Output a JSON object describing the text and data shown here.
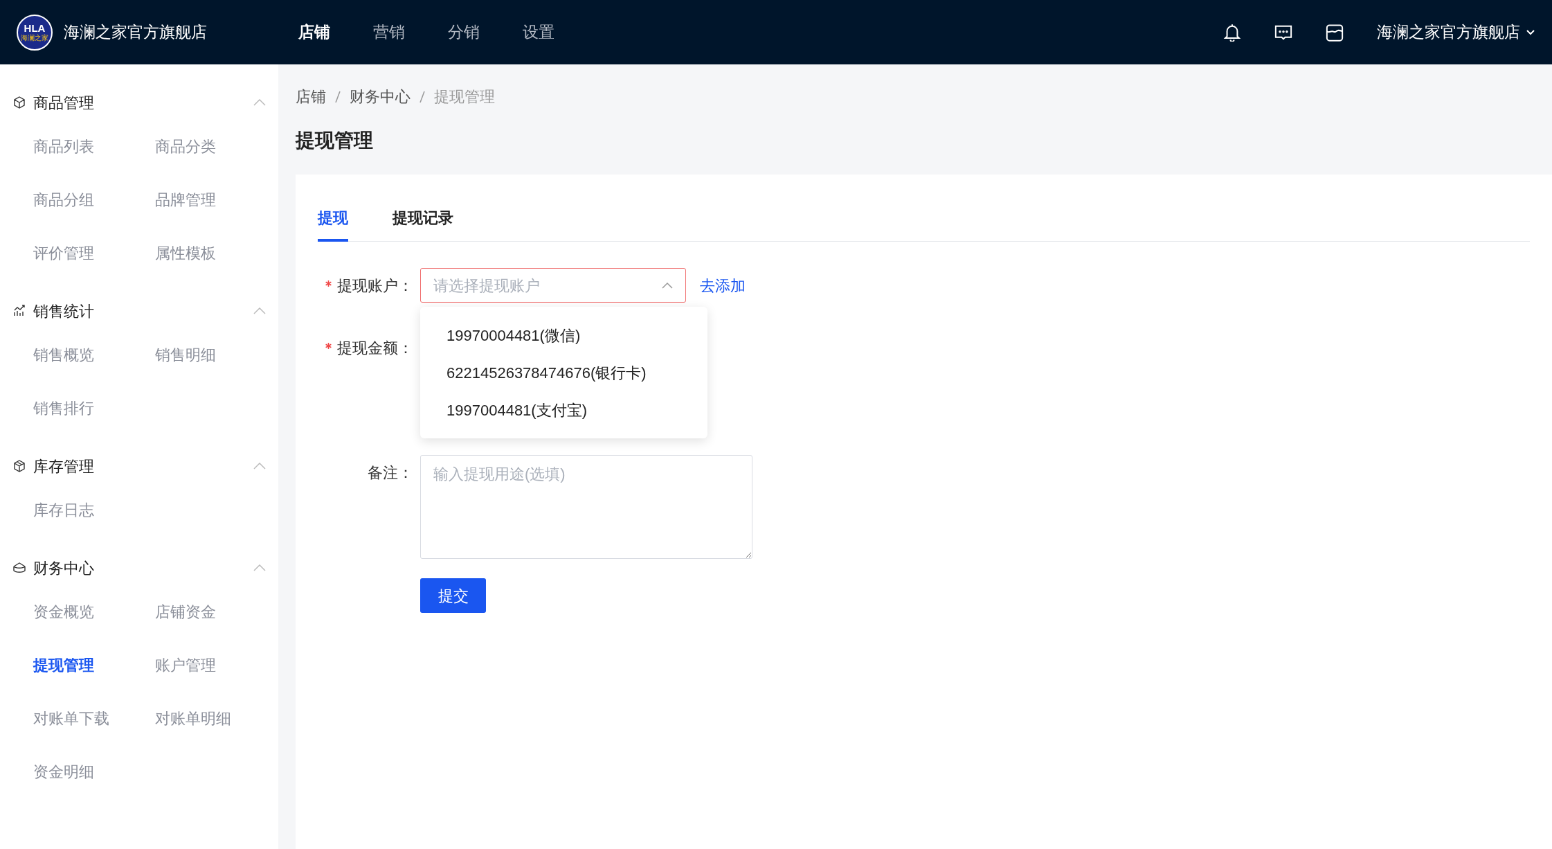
{
  "header": {
    "logo": {
      "text": "HLA",
      "subtext": "海澜之家"
    },
    "store_name": "海澜之家官方旗舰店",
    "nav": [
      {
        "label": "店铺",
        "selected": true
      },
      {
        "label": "营销",
        "selected": false
      },
      {
        "label": "分销",
        "selected": false
      },
      {
        "label": "设置",
        "selected": false
      }
    ],
    "account": "海澜之家官方旗舰店"
  },
  "sidebar": {
    "groups": [
      {
        "label": "商品管理",
        "expanded": true,
        "items": [
          {
            "label": "商品列表",
            "selected": false
          },
          {
            "label": "商品分类",
            "selected": false
          },
          {
            "label": "商品分组",
            "selected": false
          },
          {
            "label": "品牌管理",
            "selected": false
          },
          {
            "label": "评价管理",
            "selected": false
          },
          {
            "label": "属性模板",
            "selected": false
          }
        ]
      },
      {
        "label": "销售统计",
        "expanded": true,
        "items": [
          {
            "label": "销售概览",
            "selected": false
          },
          {
            "label": "销售明细",
            "selected": false
          },
          {
            "label": "销售排行",
            "selected": false
          }
        ]
      },
      {
        "label": "库存管理",
        "expanded": true,
        "items": [
          {
            "label": "库存日志",
            "selected": false
          }
        ]
      },
      {
        "label": "财务中心",
        "expanded": true,
        "items": [
          {
            "label": "资金概览",
            "selected": false
          },
          {
            "label": "店铺资金",
            "selected": false
          },
          {
            "label": "提现管理",
            "selected": true
          },
          {
            "label": "账户管理",
            "selected": false
          },
          {
            "label": "对账单下载",
            "selected": false
          },
          {
            "label": "对账单明细",
            "selected": false
          },
          {
            "label": "资金明细",
            "selected": false
          }
        ]
      }
    ]
  },
  "breadcrumb": [
    "店铺",
    "财务中心",
    "提现管理"
  ],
  "page_title": "提现管理",
  "tabs": [
    {
      "label": "提现",
      "selected": true
    },
    {
      "label": "提现记录",
      "selected": false
    }
  ],
  "form": {
    "account": {
      "label": "提现账户：",
      "required": true,
      "placeholder": "请选择提现账户",
      "invalid": true,
      "expanded": true,
      "link": "去添加",
      "options": [
        "19970004481(微信)",
        "62214526378474676(银行卡)",
        "1997004481(支付宝)"
      ]
    },
    "amount": {
      "label": "提现金额：",
      "required": true
    },
    "remark": {
      "label": "备注：",
      "placeholder": "输入提现用途(选填)"
    },
    "submit": "提交"
  }
}
